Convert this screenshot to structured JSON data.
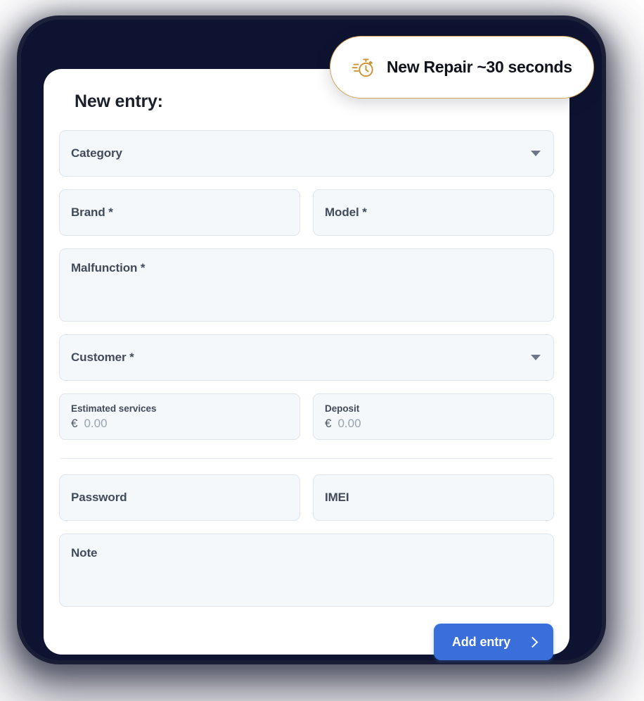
{
  "badge": {
    "icon": "stopwatch-icon",
    "text": "New Repair  ~30 seconds",
    "border_color": "#d8a556",
    "icon_color": "#c9922f"
  },
  "card": {
    "title": "New entry:",
    "background": "#ffffff"
  },
  "form": {
    "field_bg": "#f4f8fb",
    "field_border": "#dfe5ec",
    "fields": {
      "category": {
        "placeholder": "Category",
        "type": "select",
        "caret_icon": "chevron-down-icon"
      },
      "brand": {
        "placeholder": "Brand *",
        "type": "text"
      },
      "model": {
        "placeholder": "Model *",
        "type": "text"
      },
      "malfunction": {
        "placeholder": "Malfunction *",
        "type": "textarea"
      },
      "customer": {
        "placeholder": "Customer *",
        "type": "select",
        "caret_icon": "chevron-down-icon"
      },
      "estimated_services": {
        "label": "Estimated services",
        "currency": "€",
        "value": "0.00",
        "type": "money"
      },
      "deposit": {
        "label": "Deposit",
        "currency": "€",
        "value": "0.00",
        "type": "money"
      },
      "password": {
        "placeholder": "Password",
        "type": "text"
      },
      "imei": {
        "placeholder": "IMEI",
        "type": "text"
      },
      "note": {
        "placeholder": "Note",
        "type": "textarea"
      }
    }
  },
  "footer": {
    "submit_label": "Add entry",
    "submit_icon": "chevron-right-icon",
    "submit_color": "#3a6fdb"
  }
}
